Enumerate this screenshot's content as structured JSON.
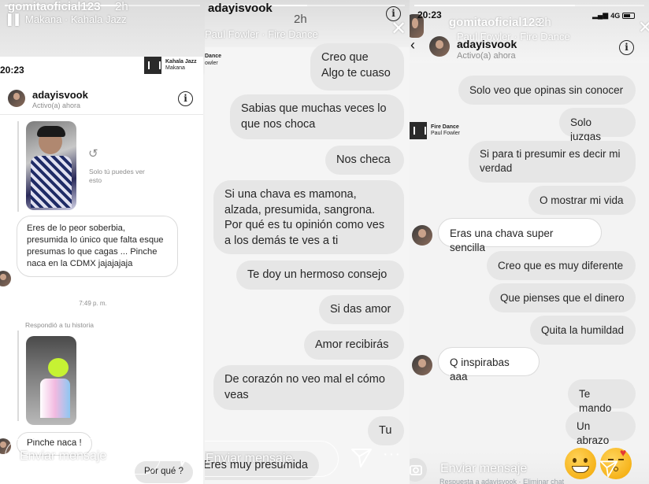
{
  "story1": {
    "username": "gomitaoficial123",
    "time_ago": "2h",
    "music": "Makana · Kahala Jazz",
    "dm": {
      "clock": "20:23",
      "music_title": "Kahala Jazz",
      "music_artist": "Makana",
      "contact_name": "adayisvook",
      "contact_status": "Activo(a) ahora",
      "only_you_text": "Solo tú puedes ver esto",
      "msg1": "Eres de lo peor soberbia, presumida lo único que falta esque presumas lo que cagas ... Pinche naca en la CDMX jajajajaja",
      "timestamp": "7:49 p. m.",
      "replied_label": "Respondió a tu historia",
      "msg2": "Pinche naca !",
      "msg3": "Por qué ?"
    },
    "send_placeholder": "Enviar mensaje"
  },
  "story2": {
    "username": "adayisvook",
    "time_ago": "2h",
    "music": "Paul Fowler · Fire Dance",
    "music_partial_1": "Dance",
    "music_partial_2": "owler",
    "messages": [
      "Creo que\nAlgo te cuaso",
      "Sabias que muchas veces lo que nos choca",
      "Nos checa",
      "Si una chava es mamona, alzada, presumida, sangrona. Por qué es tu opinión como ves a los demás te ves a ti",
      "Te doy un hermoso consejo",
      "Si das amor",
      "Amor recibirás",
      "De corazón no veo mal el cómo veas",
      "Tu",
      "Eres muy presumida"
    ],
    "send_placeholder": "Enviar mensaje"
  },
  "story3": {
    "username": "gomitaoficial123",
    "time_ago": "2h",
    "music": "Paul Fowler · Fire Dance",
    "clock": "20:23",
    "network": "4G",
    "contact_name": "adayisvook",
    "contact_status": "Activo(a) ahora",
    "music_title": "Fire Dance",
    "music_artist": "Paul Fowler",
    "messages_out_1": [
      "Solo veo que opinas sin conocer",
      "Solo juzgas",
      "Si para ti presumir es decir mi verdad",
      "O mostrar mi vida"
    ],
    "message_in_1": "Eras una chava super sencilla",
    "messages_out_2": [
      "Creo que es muy diferente",
      "Que pienses que el dinero",
      "Quita la humildad"
    ],
    "message_in_2": "Q inspirabas aaa",
    "messages_out_3": [
      "Te mando",
      "Un abrazo"
    ],
    "send_placeholder": "Enviar mensaje",
    "footer_hint": "Respuesta a adayisvook · Eliminar chat"
  },
  "icons": {
    "send": "paper-plane-icon",
    "camera": "camera-icon",
    "info": "info-icon",
    "more": "more-icon",
    "close": "close-icon",
    "back": "chevron-left-icon"
  }
}
